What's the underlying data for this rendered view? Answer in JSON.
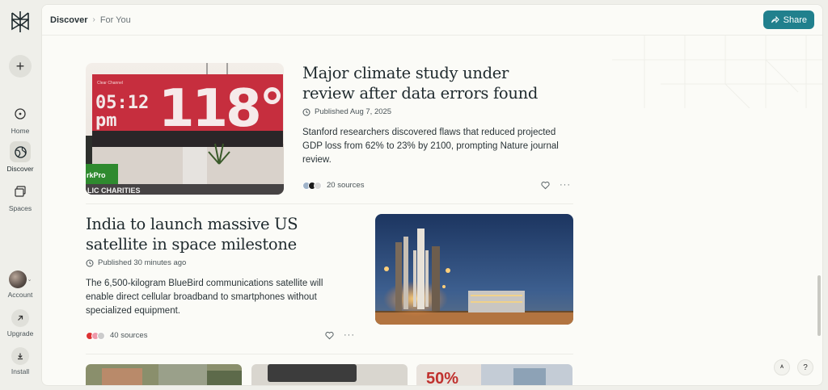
{
  "sidebar": {
    "logo_icon": "perplexity-logo-icon",
    "new_icon": "plus-icon",
    "items": [
      {
        "label": "Home",
        "icon": "compass-icon"
      },
      {
        "label": "Discover",
        "icon": "globe-icon"
      },
      {
        "label": "Spaces",
        "icon": "spaces-icon"
      },
      {
        "label": "Account",
        "icon": "avatar"
      },
      {
        "label": "Upgrade",
        "icon": "arrow-up-right-icon"
      },
      {
        "label": "Install",
        "icon": "download-icon"
      }
    ]
  },
  "header": {
    "crumb_discover": "Discover",
    "crumb_current": "For You",
    "share_label": "Share"
  },
  "articles": [
    {
      "headline": "Major climate study under review after data errors found",
      "published": "Published Aug 7, 2025",
      "summary": "Stanford researchers discovered flaws that reduced projected GDP loss from 62% to 23% by 2100, prompting Nature journal review.",
      "sources": "20 sources",
      "image": {
        "time_text": "05:12 pm",
        "temp_text": "118°",
        "banner": "LIC CHARITIES",
        "logo_text": "Clear Channel Outdoor"
      }
    },
    {
      "headline": "India to launch massive US satellite in space milestone",
      "published": "Published 30 minutes ago",
      "summary": "The 6,500-kilogram BlueBird communications satellite will enable direct cellular broadband to smartphones without specialized equipment.",
      "sources": "40 sources"
    }
  ],
  "thumbs": [
    {
      "text": ""
    },
    {
      "text": ""
    },
    {
      "text": "50%"
    }
  ],
  "colors": {
    "accent": "#21808d",
    "background": "#fbfbf7",
    "sidebar": "#efefea"
  }
}
